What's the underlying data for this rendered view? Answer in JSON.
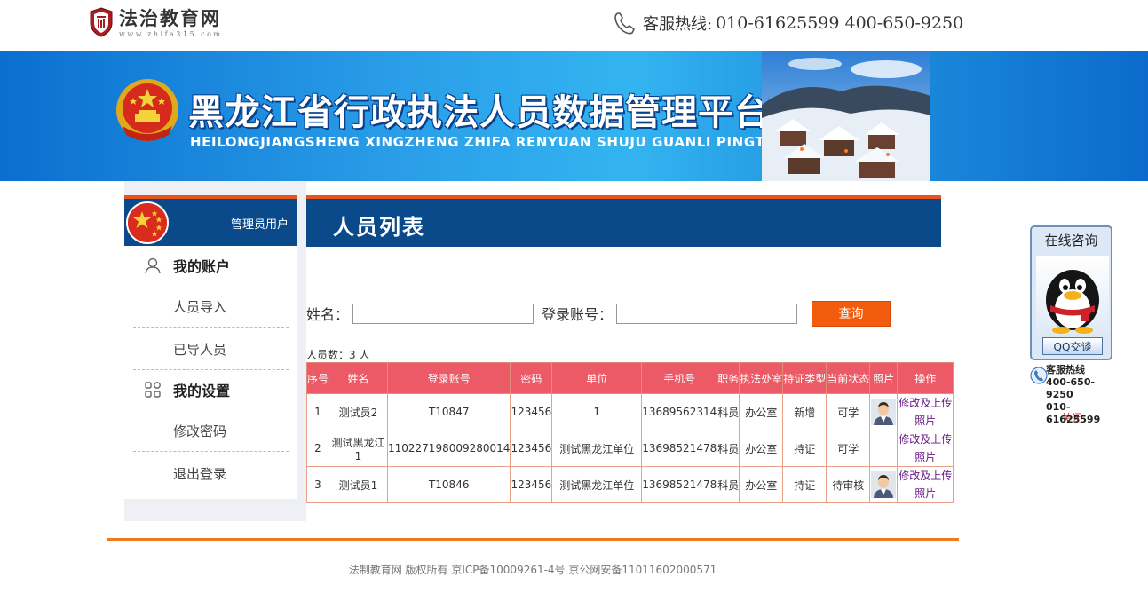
{
  "header": {
    "logo_title": "法治教育网",
    "logo_url": "www.zhifa315.com",
    "hotline_label": "客服热线:",
    "hotline_numbers": "010-61625599  400-650-9250"
  },
  "banner": {
    "title": "黑龙江省行政执法人员数据管理平台",
    "subtitle": "HEILONGJIANGSHENG XINGZHENG ZHIFA RENYUAN SHUJU GUANLI PINGTAI"
  },
  "sidebar": {
    "user_label": "管理员用户",
    "sections": [
      {
        "title": "我的账户",
        "items": [
          "人员导入",
          "已导人员"
        ]
      },
      {
        "title": "我的设置",
        "items": [
          "修改密码",
          "退出登录"
        ]
      }
    ]
  },
  "main": {
    "title": "人员列表",
    "search": {
      "name_label": "姓名：",
      "account_label": "登录账号：",
      "name_value": "",
      "account_value": "",
      "button": "查询"
    },
    "count_text": "人员数：3 人",
    "table": {
      "columns": [
        "序号",
        "姓名",
        "登录账号",
        "密码",
        "单位",
        "手机号",
        "职务",
        "执法处室",
        "持证类型",
        "当前状态",
        "照片",
        "操作"
      ],
      "rows": [
        {
          "no": "1",
          "name": "测试员2",
          "account": "T10847",
          "password": "123456",
          "unit": "1",
          "phone": "13689562314",
          "position": "科员",
          "office": "办公室",
          "cert": "新增",
          "status": "可学",
          "photo": true,
          "op1": "修改及上传",
          "op2": "照片"
        },
        {
          "no": "2",
          "name": "测试黑龙江1",
          "account": "110227198009280014",
          "password": "123456",
          "unit": "测试黑龙江单位",
          "phone": "13698521478",
          "position": "科员",
          "office": "办公室",
          "cert": "持证",
          "status": "可学",
          "photo": false,
          "op1": "修改及上传",
          "op2": "照片"
        },
        {
          "no": "3",
          "name": "测试员1",
          "account": "T10846",
          "password": "123456",
          "unit": "测试黑龙江单位",
          "phone": "13698521478",
          "position": "科员",
          "office": "办公室",
          "cert": "持证",
          "status": "待审核",
          "photo": true,
          "op1": "修改及上传",
          "op2": "照片"
        }
      ]
    }
  },
  "footer": {
    "text": "法制教育网 版权所有 京ICP备10009261-4号 京公网安备11011602000571"
  },
  "float_widget": {
    "title": "在线咨询",
    "qq_button": "QQ交谈",
    "hotline_label": "客服热线",
    "hotline_1": "400-650-9250",
    "hotline_2": "010-61625599",
    "close": "关闭"
  },
  "colors": {
    "nav_blue": "#0b4a8a",
    "accent_orange": "#e8541d",
    "table_header": "#ec5a67",
    "search_button": "#f35c0d"
  }
}
